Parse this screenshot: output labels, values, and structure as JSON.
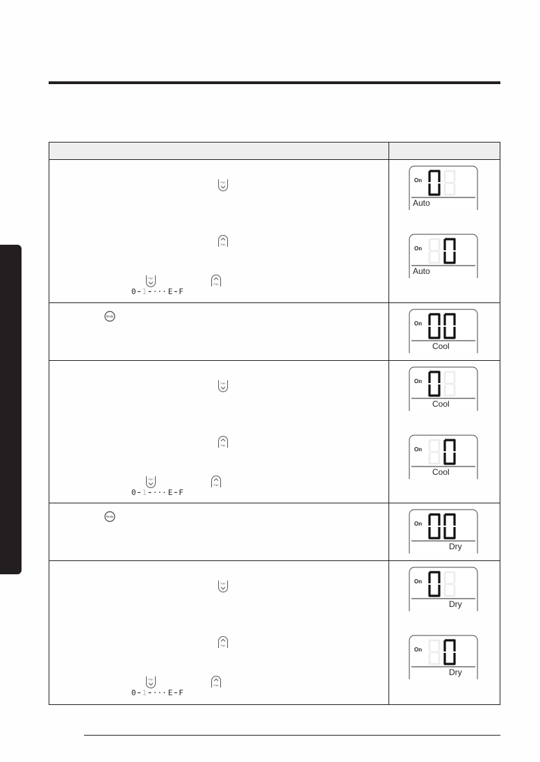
{
  "page": {
    "side_tab": "section-tab",
    "table_header": {
      "col1": "",
      "col2": ""
    }
  },
  "icons": {
    "fan_down": {
      "label": "Fan",
      "glyph": "⌄"
    },
    "fan_up": {
      "label": "Fan",
      "glyph": "⌃"
    },
    "mode": {
      "label": "Mode"
    }
  },
  "sequence": [
    "0",
    "1",
    "···",
    "E",
    "F"
  ],
  "rows": [
    {
      "displays": [
        {
          "on": "On",
          "digits": [
            "0",
            ""
          ],
          "mode": "Auto"
        },
        {
          "on": "On",
          "digits": [
            "",
            "0"
          ],
          "mode": "Auto"
        }
      ]
    },
    {
      "displays": [
        {
          "on": "On",
          "digits": [
            "0",
            "0"
          ],
          "mode": "Cool"
        }
      ]
    },
    {
      "displays": [
        {
          "on": "On",
          "digits": [
            "0",
            ""
          ],
          "mode": "Cool"
        },
        {
          "on": "On",
          "digits": [
            "",
            "0"
          ],
          "mode": "Cool"
        }
      ]
    },
    {
      "displays": [
        {
          "on": "On",
          "digits": [
            "0",
            "0"
          ],
          "mode": "Dry"
        }
      ]
    },
    {
      "displays": [
        {
          "on": "On",
          "digits": [
            "0",
            ""
          ],
          "mode": "Dry"
        },
        {
          "on": "On",
          "digits": [
            "",
            "0"
          ],
          "mode": "Dry"
        }
      ]
    }
  ]
}
